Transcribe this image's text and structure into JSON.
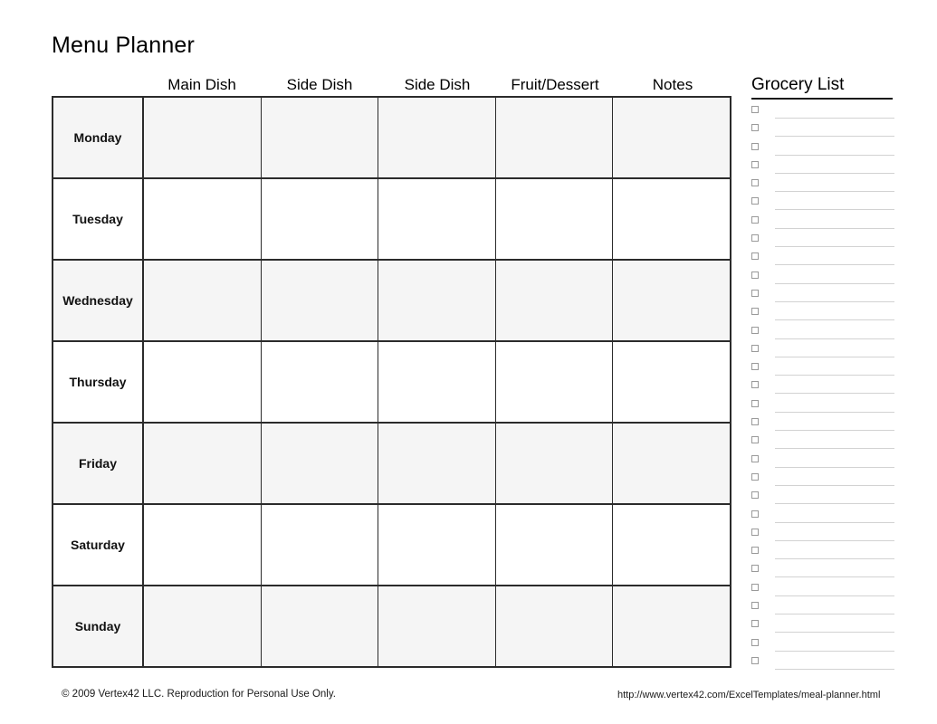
{
  "document": {
    "title": "Menu Planner"
  },
  "planner": {
    "columns": [
      "Main Dish",
      "Side Dish",
      "Side Dish",
      "Fruit/Dessert",
      "Notes"
    ],
    "rows": [
      {
        "day": "Monday",
        "shaded": true,
        "cells": [
          "",
          "",
          "",
          "",
          ""
        ]
      },
      {
        "day": "Tuesday",
        "shaded": false,
        "cells": [
          "",
          "",
          "",
          "",
          ""
        ]
      },
      {
        "day": "Wednesday",
        "shaded": true,
        "cells": [
          "",
          "",
          "",
          "",
          ""
        ]
      },
      {
        "day": "Thursday",
        "shaded": false,
        "cells": [
          "",
          "",
          "",
          "",
          ""
        ]
      },
      {
        "day": "Friday",
        "shaded": true,
        "cells": [
          "",
          "",
          "",
          "",
          ""
        ]
      },
      {
        "day": "Saturday",
        "shaded": false,
        "cells": [
          "",
          "",
          "",
          "",
          ""
        ]
      },
      {
        "day": "Sunday",
        "shaded": true,
        "cells": [
          "",
          "",
          "",
          "",
          ""
        ]
      }
    ]
  },
  "grocery": {
    "title": "Grocery List",
    "row_count": 31,
    "items": [
      "",
      "",
      "",
      "",
      "",
      "",
      "",
      "",
      "",
      "",
      "",
      "",
      "",
      "",
      "",
      "",
      "",
      "",
      "",
      "",
      "",
      "",
      "",
      "",
      "",
      "",
      "",
      "",
      "",
      "",
      ""
    ]
  },
  "footer": {
    "copyright": "© 2009 Vertex42 LLC. Reproduction for Personal Use Only.",
    "url": "http://www.vertex42.com/ExcelTemplates/meal-planner.html"
  },
  "colors": {
    "shaded_row": "#f5f5f5",
    "grid_line": "#2b2b2b",
    "grocery_line": "#d2d2d2",
    "checkbox_border": "#9a9a9a"
  }
}
